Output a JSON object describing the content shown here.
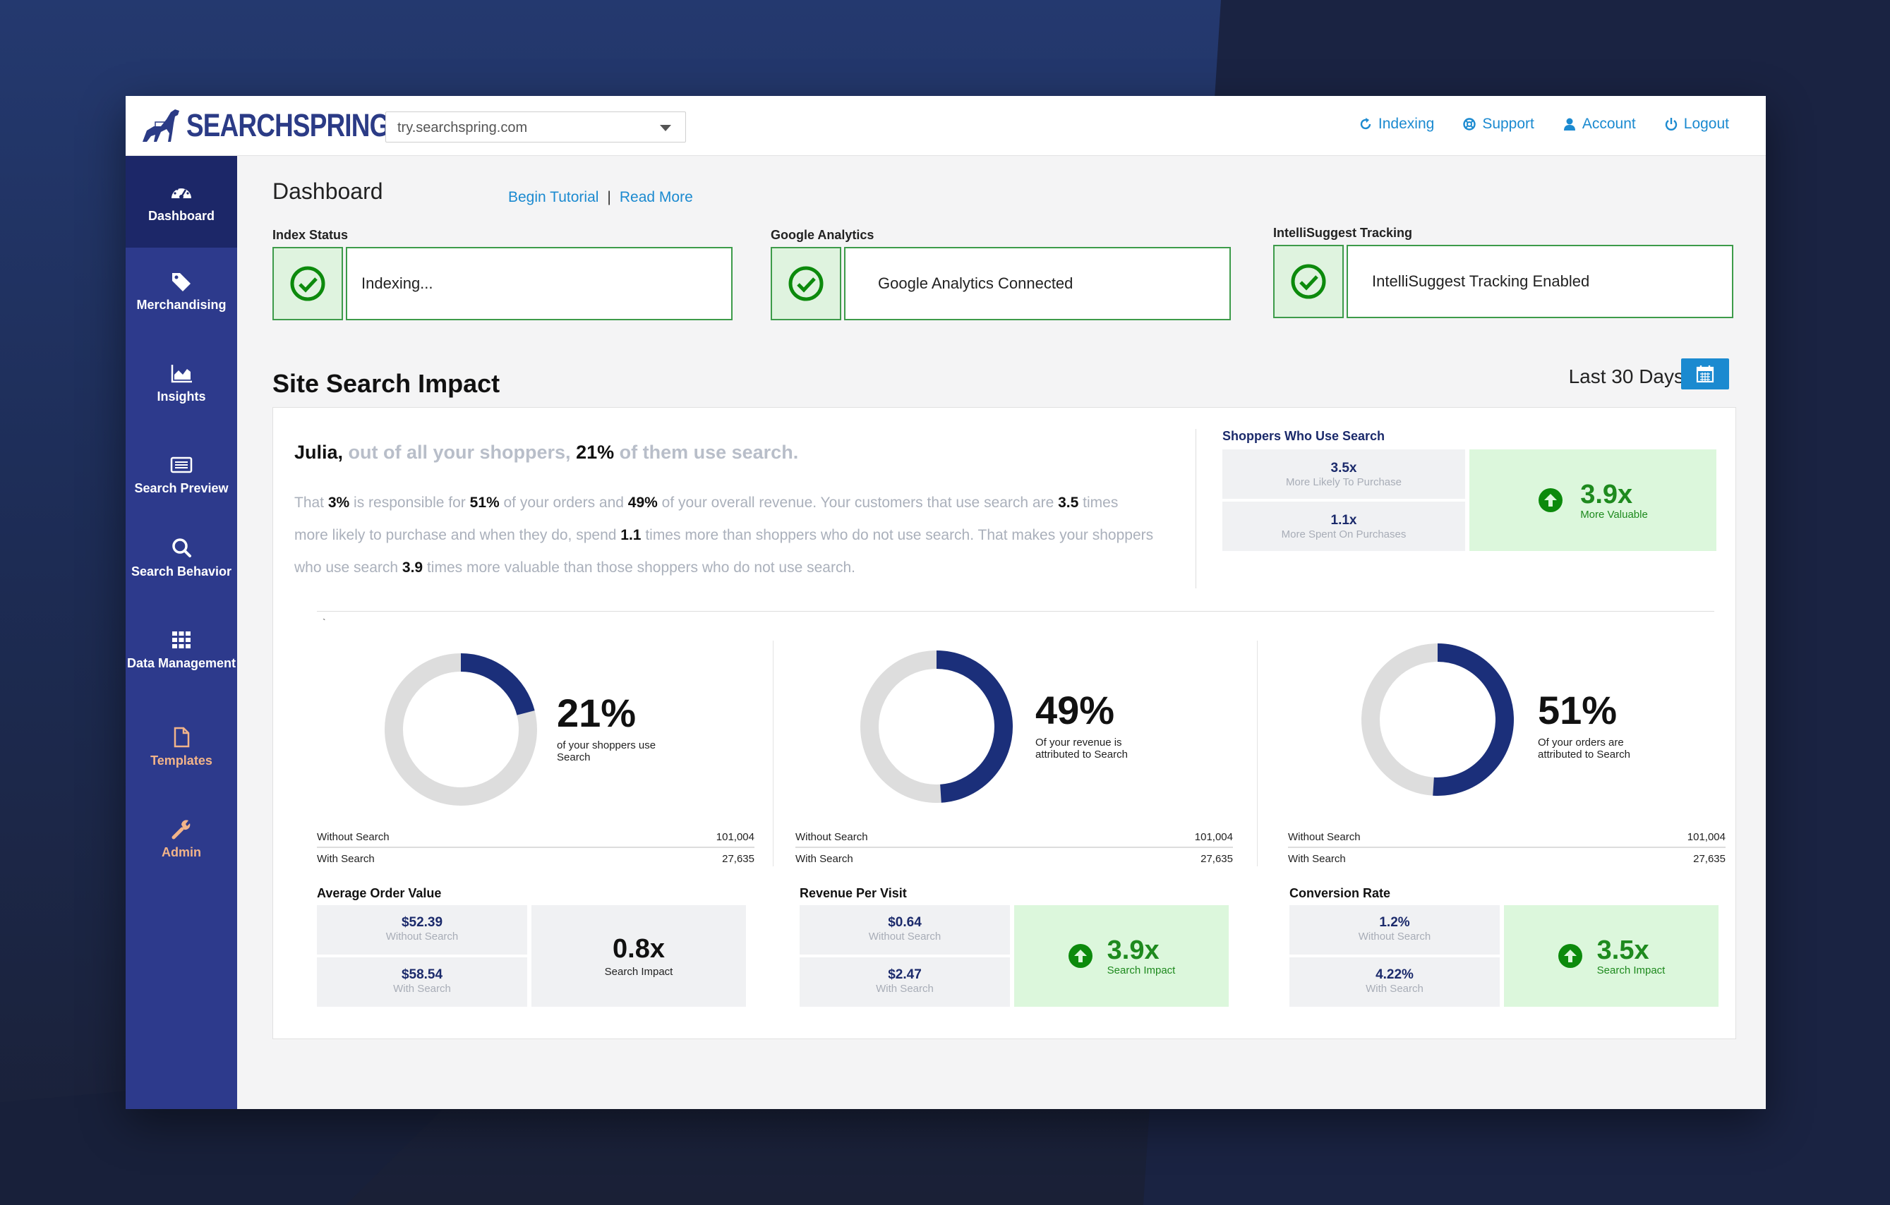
{
  "brand": {
    "name": "SEARCHSPRING"
  },
  "site_selector": {
    "value": "try.searchspring.com"
  },
  "topnav": [
    {
      "label": "Indexing",
      "icon": "refresh-icon"
    },
    {
      "label": "Support",
      "icon": "lifebuoy-icon"
    },
    {
      "label": "Account",
      "icon": "user-icon"
    },
    {
      "label": "Logout",
      "icon": "power-icon"
    }
  ],
  "sidebar": {
    "items": [
      {
        "label": "Dashboard",
        "icon": "dashboard-icon",
        "active": true
      },
      {
        "label": "Merchandising",
        "icon": "tag-icon"
      },
      {
        "label": "Insights",
        "icon": "area-chart-icon"
      },
      {
        "label": "Search Preview",
        "icon": "preview-icon"
      },
      {
        "label": "Search Behavior",
        "icon": "search-icon"
      },
      {
        "label": "Data Management",
        "icon": "grid-icon"
      },
      {
        "label": "Templates",
        "icon": "file-icon"
      },
      {
        "label": "Admin",
        "icon": "wrench-icon"
      }
    ]
  },
  "header": {
    "title": "Dashboard",
    "begin_tutorial": "Begin Tutorial",
    "separator": "|",
    "read_more": "Read More"
  },
  "status": [
    {
      "label": "Index Status",
      "text": "Indexing..."
    },
    {
      "label": "Google Analytics",
      "text": "Google Analytics Connected"
    },
    {
      "label": "IntelliSuggest Tracking",
      "text": "IntelliSuggest Tracking Enabled"
    }
  ],
  "impact": {
    "title": "Site Search Impact",
    "period": "Last 30 Days",
    "greeting": {
      "name": "Julia,",
      "pre": " out of all your shoppers, ",
      "pct": "21%",
      "post": " of them use search."
    },
    "para": {
      "t1": "That ",
      "v1": "3%",
      "t2": " is responsible for ",
      "v2": "51%",
      "t3": " of your orders and ",
      "v3": "49%",
      "t4": " of your overall revenue. Your customers that use search are ",
      "v4": "3.5",
      "t5": " times more likely to purchase and when they do, spend ",
      "v5": "1.1",
      "t6": " times more than shoppers who do not use search. That makes your shoppers who use search ",
      "v6": "3.9",
      "t7": " times more valuable than those shoppers who do not use search."
    },
    "shoppers_who_search": {
      "label": "Shoppers Who Use Search",
      "likely": {
        "value": "3.5x",
        "sub": "More Likely To Purchase"
      },
      "spent": {
        "value": "1.1x",
        "sub": "More Spent On Purchases"
      },
      "valuable": {
        "value": "3.9x",
        "sub": "More Valuable"
      }
    },
    "tick": "`"
  },
  "donuts": [
    {
      "pct": "21%",
      "fraction": 0.21,
      "caption": "of your shoppers use Search",
      "without_label": "Without Search",
      "without_value": "101,004",
      "with_label": "With Search",
      "with_value": "27,635"
    },
    {
      "pct": "49%",
      "fraction": 0.49,
      "caption": "Of your revenue is attributed to Search",
      "without_label": "Without Search",
      "without_value": "101,004",
      "with_label": "With Search",
      "with_value": "27,635"
    },
    {
      "pct": "51%",
      "fraction": 0.51,
      "caption": "Of your orders are attributed to Search",
      "without_label": "Without Search",
      "without_value": "101,004",
      "with_label": "With Search",
      "with_value": "27,635"
    }
  ],
  "metrics": [
    {
      "label": "Average Order Value",
      "without": "$52.39",
      "without_sub": "Without Search",
      "with": "$58.54",
      "with_sub": "With Search",
      "impact": "0.8x",
      "impact_sub": "Search Impact"
    },
    {
      "label": "Revenue Per Visit",
      "without": "$0.64",
      "without_sub": "Without Search",
      "with": "$2.47",
      "with_sub": "With Search",
      "impact": "3.9x",
      "impact_sub": "Search Impact"
    },
    {
      "label": "Conversion Rate",
      "without": "1.2%",
      "without_sub": "Without Search",
      "with": "4.22%",
      "with_sub": "With Search",
      "impact": "3.5x",
      "impact_sub": "Search Impact"
    }
  ],
  "colors": {
    "accent": "#1b8ad0",
    "sidebar": "#2d3a8c",
    "donut_fill": "#1b2f7a",
    "donut_track": "#dddddd",
    "success": "#1e8a1e",
    "success_bg": "#dcf7dc"
  }
}
